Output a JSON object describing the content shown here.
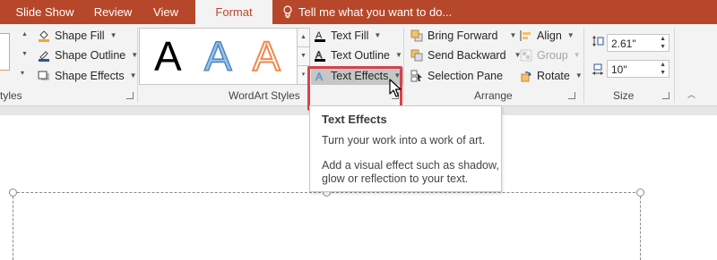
{
  "tabs": [
    {
      "label": "Slide Show",
      "active": false
    },
    {
      "label": "Review",
      "active": false
    },
    {
      "label": "View",
      "active": false
    },
    {
      "label": "Format",
      "active": true
    }
  ],
  "tell_me": "Tell me what you want to do...",
  "colors": {
    "accent": "#b7472a",
    "highlight": "#d5434a",
    "ribbon_bg": "#f3f3f3"
  },
  "shape_styles": {
    "group_label_partial": "tyles",
    "shape_fill": "Shape Fill",
    "shape_outline": "Shape Outline",
    "shape_effects": "Shape Effects"
  },
  "wordart": {
    "group_label": "WordArt Styles",
    "gallery": [
      "A",
      "A",
      "A"
    ],
    "text_fill": "Text Fill",
    "text_outline": "Text Outline",
    "text_effects": "Text Effects"
  },
  "arrange": {
    "group_label": "Arrange",
    "bring_forward": "Bring Forward",
    "send_backward": "Send Backward",
    "selection_pane": "Selection Pane",
    "align": "Align",
    "group": "Group",
    "rotate": "Rotate"
  },
  "size": {
    "group_label": "Size",
    "height": "2.61\"",
    "width": "10\""
  },
  "tooltip": {
    "title": "Text Effects",
    "line1": "Turn your work into a work of art.",
    "line2": "Add a visual effect such as shadow,",
    "line3": "glow or reflection to your text."
  }
}
